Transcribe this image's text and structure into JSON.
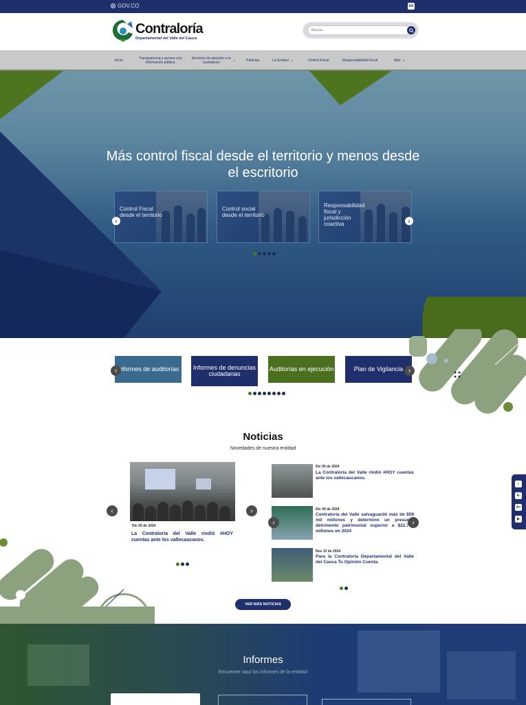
{
  "govbar": {
    "label": "GOV.CO",
    "lang": "EN"
  },
  "header": {
    "logo_name": "Contraloría",
    "logo_sub": "Departamental del Valle del Cauca",
    "search_placeholder": "Buscar..."
  },
  "nav": [
    {
      "label": "Inicio",
      "chevron": false
    },
    {
      "label": "Transparencia y acceso a la información pública",
      "chevron": false
    },
    {
      "label": "Servicios de atención a la ciudadanía",
      "chevron": true
    },
    {
      "label": "Participa",
      "chevron": false
    },
    {
      "label": "La Entidad",
      "chevron": true
    },
    {
      "label": "Control Fiscal",
      "chevron": false
    },
    {
      "label": "Responsabilidad Fiscal",
      "chevron": false
    },
    {
      "label": "Más",
      "chevron": true
    }
  ],
  "hero": {
    "title": "Más control fiscal desde el territorio y menos desde el escritorio",
    "cards": [
      {
        "label": "Control Fiscal desde el territorio"
      },
      {
        "label": "Control social desde el territorio"
      },
      {
        "label": "Responsabilidad fiscal y jurisdicción coactiva"
      }
    ],
    "dots": 5,
    "active_dot": 0
  },
  "quick": {
    "buttons": [
      {
        "label": "Informes de auditorías",
        "color": "#3a6b8e"
      },
      {
        "label": "Informes de denuncias ciudadanas",
        "color": "#1f2f6c"
      },
      {
        "label": "Auditorías en ejecución",
        "color": "#4a6f1e"
      },
      {
        "label": "Plan de Vigilancia",
        "color": "#1f2f6c"
      }
    ],
    "dots": 8,
    "active_dot": 0
  },
  "noticias": {
    "title": "Noticias",
    "subtitle": "Novedades de nuestra entidad",
    "main": {
      "date": "Dic 05 de 2024",
      "title": "La Contraloría del Valle rindió #HOY cuentas ante los vallecaucanos."
    },
    "main_dots": 3,
    "list": [
      {
        "date": "Dic 05 de 2024",
        "title": "La Contraloría del Valle rindió #HOY cuentas ante los vallecaucanos."
      },
      {
        "date": "Dic 05 de 2024",
        "title": "Contraloría del Valle salvaguardó más de $59 mil millones y determinó un presunto detrimento patrimonial superior a $22.700 millones en 2024"
      },
      {
        "date": "Nov 12 de 2024",
        "title": "Para la Contraloría Departamental del Valle del Cauca Tu Opinión Cuenta."
      }
    ],
    "list_dots": 2,
    "more_label": "VER MÁS NOTICIAS"
  },
  "access": [
    "contrast-icon",
    "text-decrease-icon",
    "text-increase-icon",
    "reader-icon"
  ],
  "informes": {
    "title": "Informes",
    "subtitle": "Encuentre aquí los informes de la entidad"
  }
}
